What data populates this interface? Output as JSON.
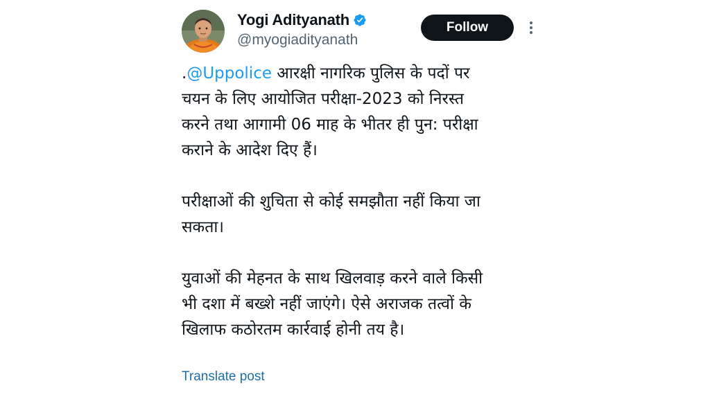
{
  "author": {
    "display_name": "Yogi Adityanath",
    "handle": "@myogiadityanath",
    "verified": true,
    "avatar_icon": "profile-photo"
  },
  "actions": {
    "follow_label": "Follow",
    "more_icon": "more-vertical-icon"
  },
  "tweet": {
    "mention": "@Uppolice",
    "para1_prefix": ".",
    "para1_line1_rest": " आरक्षी नागरिक पुलिस के पदों पर",
    "para1_line2": "चयन के लिए आयोजित परीक्षा-2023 को निरस्त",
    "para1_line3": "करने तथा आगामी 06 माह के भीतर ही पुन: परीक्षा",
    "para1_line4": "कराने के आदेश दिए हैं।",
    "para2_line1": "परीक्षाओं की शुचिता से कोई समझौता नहीं किया जा",
    "para2_line2": "सकता।",
    "para3_line1": "युवाओं की मेहनत के साथ खिलवाड़ करने वाले किसी",
    "para3_line2": "भी दशा में बख्शे नहीं जाएंगे। ऐसे अराजक तत्वों के",
    "para3_line3": "खिलाफ कठोरतम कार्रवाई होनी तय है।"
  },
  "translate_label": "Translate post",
  "colors": {
    "link": "#1d9bf0",
    "verified_badge": "#1d9bf0",
    "follow_bg": "#0f1419",
    "text": "#0f1419",
    "muted": "#536471"
  }
}
